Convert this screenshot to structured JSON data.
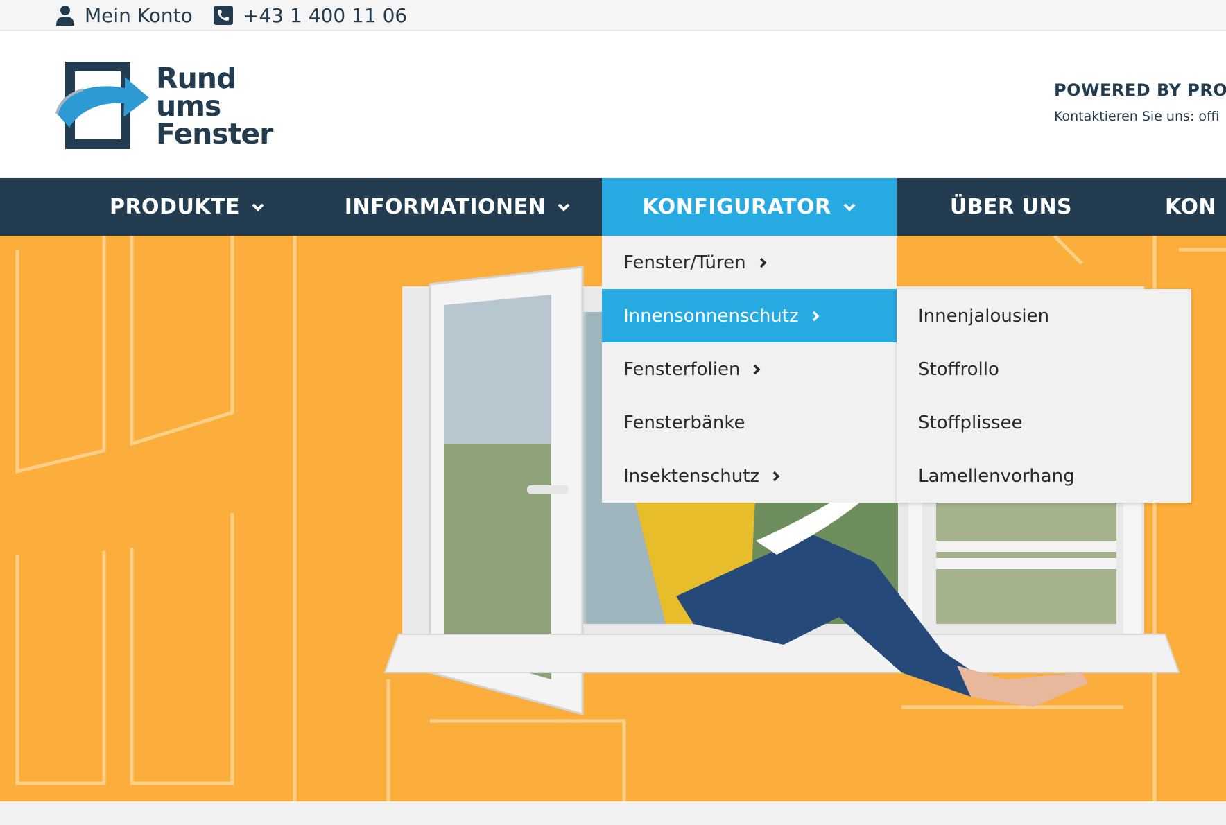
{
  "topbar": {
    "account_label": "Mein Konto",
    "phone_label": "+43 1 400 11 06"
  },
  "header": {
    "logo_lines": [
      "Rund",
      "ums",
      "Fenster"
    ],
    "powered_by": "POWERED BY PROF",
    "contact": "Kontaktieren Sie uns: offi"
  },
  "nav": {
    "items": [
      {
        "label": "PRODUKTE"
      },
      {
        "label": "INFORMATIONEN"
      },
      {
        "label": "KONFIGURATOR"
      },
      {
        "label": "ÜBER UNS"
      },
      {
        "label": "KON"
      }
    ]
  },
  "dropdown": {
    "items": [
      {
        "label": "Fenster/Türen"
      },
      {
        "label": "Innensonnenschutz"
      },
      {
        "label": "Fensterfolien"
      },
      {
        "label": "Fensterbänke"
      },
      {
        "label": "Insektenschutz"
      }
    ]
  },
  "submenu": {
    "items": [
      {
        "label": "Innenjalousien"
      },
      {
        "label": "Stoffrollo"
      },
      {
        "label": "Stoffplissee"
      },
      {
        "label": "Lamellenvorhang"
      }
    ]
  },
  "colors": {
    "navy": "#243c4f",
    "accent": "#27a9e1",
    "hero_bg": "#fbae3c"
  }
}
